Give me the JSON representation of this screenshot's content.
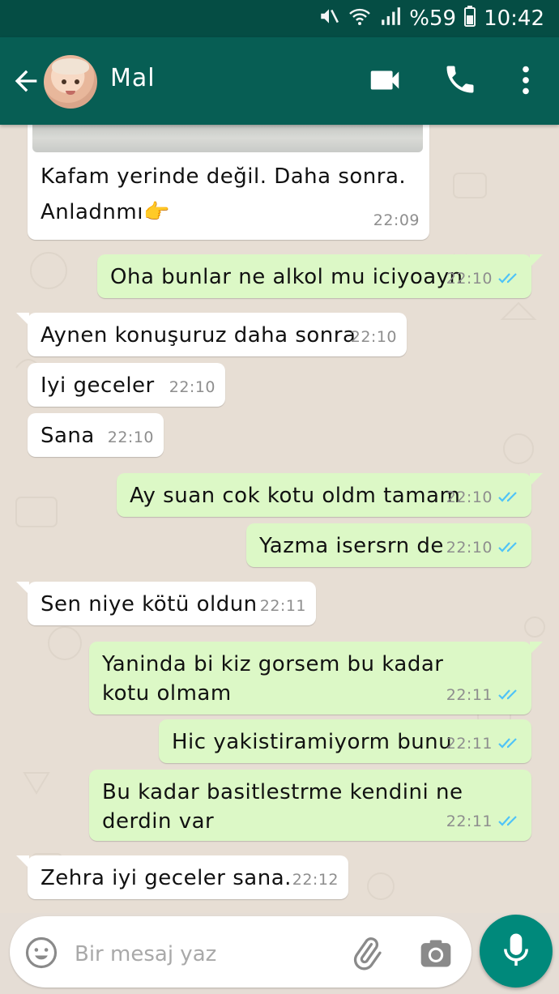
{
  "status_bar": {
    "battery_percent": "%59",
    "time": "10:42",
    "icons": [
      "mute-icon",
      "wifi-icon",
      "signal-icon",
      "battery-icon"
    ]
  },
  "header": {
    "contact_name": "Mal",
    "icons": [
      "back-arrow-icon",
      "video-call-icon",
      "phone-icon",
      "more-vert-icon"
    ]
  },
  "messages": [
    {
      "direction": "in",
      "text": "Kafam yerinde değil. Daha sonra. Anladnmı👉",
      "time": "22:09",
      "has_photo": true
    },
    {
      "direction": "out",
      "text": "Oha bunlar ne alkol mu iciyoayn",
      "time": "22:10",
      "read": true
    },
    {
      "direction": "in",
      "text": "Aynen konuşuruz daha sonra",
      "time": "22:10"
    },
    {
      "direction": "in",
      "text": "Iyi geceler",
      "time": "22:10"
    },
    {
      "direction": "in",
      "text": "Sana",
      "time": "22:10"
    },
    {
      "direction": "out",
      "text": "Ay suan cok kotu oldm tamam",
      "time": "22:10",
      "read": true
    },
    {
      "direction": "out",
      "text": "Yazma isersrn de",
      "time": "22:10",
      "read": true
    },
    {
      "direction": "in",
      "text": "Sen niye kötü oldun",
      "time": "22:11"
    },
    {
      "direction": "out",
      "text": "Yaninda bi kiz gorsem bu kadar kotu olmam",
      "time": "22:11",
      "read": true
    },
    {
      "direction": "out",
      "text": "Hic yakistiramiyorm bunu",
      "time": "22:11",
      "read": true
    },
    {
      "direction": "out",
      "text": "Bu kadar basitlestrme kendini ne derdin var",
      "time": "22:11",
      "read": true
    },
    {
      "direction": "in",
      "text": "Zehra iyi geceler sana.",
      "time": "22:12"
    }
  ],
  "input": {
    "placeholder": "Bir mesaj yaz",
    "value": ""
  },
  "colors": {
    "header": "#075e54",
    "status_bar": "#054d44",
    "outgoing_bubble": "#dcf8c6",
    "incoming_bubble": "#ffffff",
    "read_ticks": "#4fc3f7",
    "mic_button": "#00897b"
  }
}
